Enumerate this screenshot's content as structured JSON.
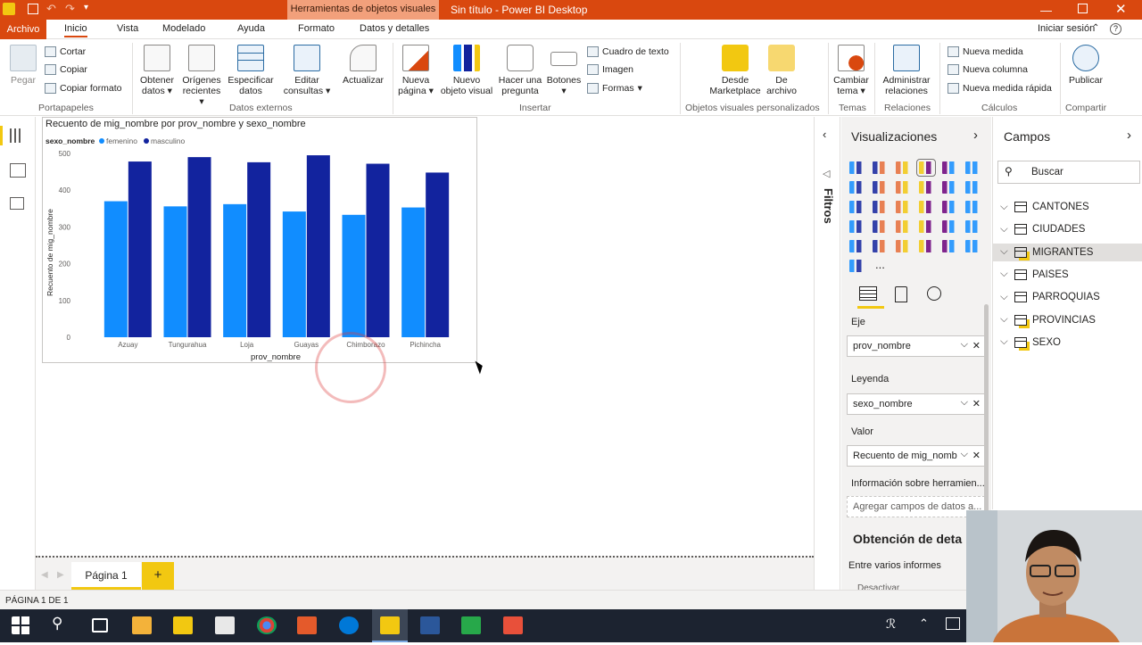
{
  "window": {
    "title": "Sin título - Power BI Desktop",
    "context_tab": "Herramientas de objetos visuales",
    "sign_in": "Iniciar sesión"
  },
  "tabs": [
    "Archivo",
    "Inicio",
    "Vista",
    "Modelado",
    "Ayuda",
    "Formato",
    "Datos y detalles"
  ],
  "ribbon": {
    "clipboard": {
      "paste": "Pegar",
      "cut": "Cortar",
      "copy": "Copiar",
      "format_painter": "Copiar formato",
      "group": "Portapapeles"
    },
    "external": {
      "get_data_1": "Obtener",
      "get_data_2": "datos",
      "recent_1": "Orígenes",
      "recent_2": "recientes",
      "enter_1": "Especificar",
      "enter_2": "datos",
      "edit_1": "Editar",
      "edit_2": "consultas",
      "refresh": "Actualizar",
      "group": "Datos externos"
    },
    "insert": {
      "new_page_1": "Nueva",
      "new_page_2": "página",
      "new_visual_1": "Nuevo",
      "new_visual_2": "objeto visual",
      "ask_1": "Hacer una",
      "ask_2": "pregunta",
      "buttons": "Botones",
      "textbox": "Cuadro de texto",
      "image": "Imagen",
      "shapes": "Formas",
      "group": "Insertar"
    },
    "custom": {
      "marketplace_1": "Desde",
      "marketplace_2": "Marketplace",
      "file_1": "De",
      "file_2": "archivo",
      "group": "Objetos visuales personalizados"
    },
    "themes": {
      "switch_1": "Cambiar",
      "switch_2": "tema",
      "group": "Temas"
    },
    "relations": {
      "manage_1": "Administrar",
      "manage_2": "relaciones",
      "group": "Relaciones"
    },
    "calc": {
      "new_measure": "Nueva medida",
      "new_column": "Nueva columna",
      "quick_measure": "Nueva medida rápida",
      "group": "Cálculos"
    },
    "share": {
      "publish": "Publicar",
      "group": "Compartir"
    }
  },
  "chart_data": {
    "type": "bar",
    "title": "Recuento de mig_nombre por prov_nombre y sexo_nombre",
    "legend_title": "sexo_nombre",
    "legend_position": "top-left",
    "categories": [
      "Azuay",
      "Tungurahua",
      "Loja",
      "Guayas",
      "Chimborazo",
      "Pichincha"
    ],
    "series": [
      {
        "name": "femenino",
        "color": "#118dff",
        "values": [
          370,
          356,
          362,
          342,
          333,
          353
        ]
      },
      {
        "name": "masculino",
        "color": "#12239e",
        "values": [
          478,
          490,
          476,
          495,
          472,
          448
        ]
      }
    ],
    "xlabel": "prov_nombre",
    "ylabel": "Recuento de mig_nombre",
    "ylim": [
      0,
      500
    ],
    "yticks": [
      "0",
      "100",
      "200",
      "300",
      "400",
      "500"
    ],
    "grid": false
  },
  "filters": {
    "label": "Filtros"
  },
  "viz": {
    "title": "Visualizaciones",
    "more": "...",
    "eje_label": "Eje",
    "eje_value": "prov_nombre",
    "leyenda_label": "Leyenda",
    "leyenda_value": "sexo_nombre",
    "valor_label": "Valor",
    "valor_value": "Recuento de mig_nomb",
    "tooltips": "Información sobre herramien...",
    "add_fields": "Agregar campos de datos a...",
    "drill_title": "Obtención de deta",
    "cross_report": "Entre varios informes",
    "toggle": "Desactivar"
  },
  "fields": {
    "title": "Campos",
    "search_placeholder": "Buscar",
    "tables": [
      "CANTONES",
      "CIUDADES",
      "MIGRANTES",
      "PAISES",
      "PARROQUIAS",
      "PROVINCIAS",
      "SEXO"
    ]
  },
  "pages": {
    "tab": "Página 1",
    "add": "+"
  },
  "status": {
    "text": "PÁGINA 1 DE 1"
  }
}
